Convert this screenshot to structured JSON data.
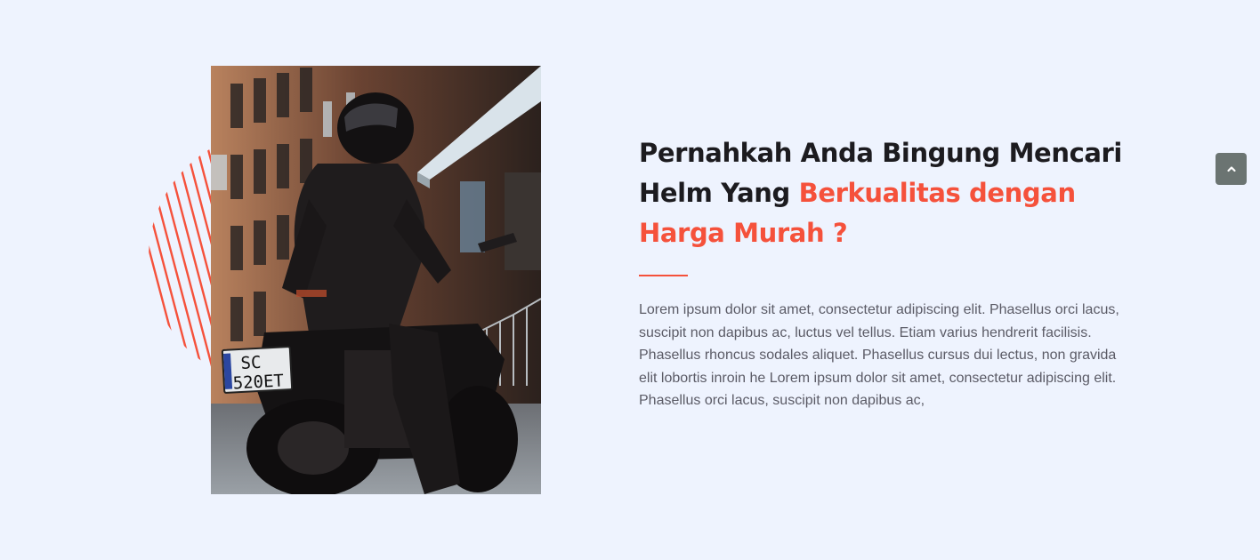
{
  "about": {
    "photo_alt": "Pengendara motor dengan helm",
    "plate_line1": "SC",
    "plate_line2": "520ET",
    "heading_plain": "Pernahkah Anda Bingung Mencari Helm Yang ",
    "heading_accent": "Berkualitas dengan Harga Murah ?",
    "paragraph": "Lorem ipsum dolor sit amet, consectetur adipiscing elit. Phasellus orci lacus, suscipit non dapibus ac, luctus vel tellus. Etiam varius hendrerit facilisis. Phasellus rhoncus sodales aliquet. Phasellus cursus dui lectus, non gravida elit lobortis inroin he Lorem ipsum dolor sit amet, consectetur adipiscing elit. Phasellus orci lacus, suscipit non dapibus ac,"
  },
  "scroll_top": {
    "icon": "chevron-up-icon"
  },
  "colors": {
    "background": "#eef3fe",
    "accent": "#f5513b",
    "heading": "#1c1b1f",
    "body_text": "#5b5b66",
    "scroll_button": "#6b7472"
  }
}
